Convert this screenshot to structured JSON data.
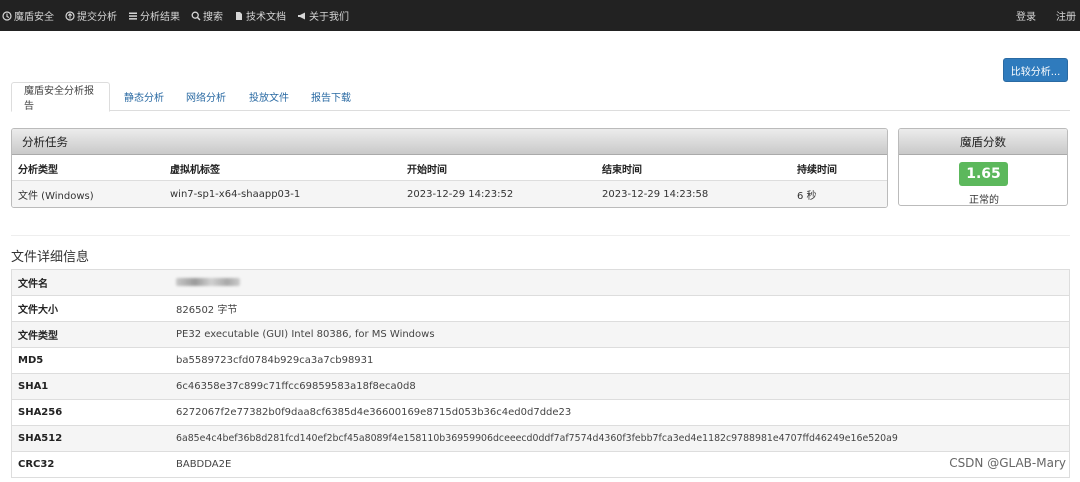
{
  "nav": {
    "items": [
      {
        "label": "魔盾安全",
        "icon": "shield-icon"
      },
      {
        "label": "提交分析",
        "icon": "upload-circle-icon"
      },
      {
        "label": "分析结果",
        "icon": "list-icon"
      },
      {
        "label": "搜索",
        "icon": "search-icon"
      },
      {
        "label": "技术文档",
        "icon": "document-icon"
      },
      {
        "label": "关于我们",
        "icon": "megaphone-icon"
      }
    ],
    "login": "登录",
    "register": "注册"
  },
  "compare_button": "比较分析...",
  "tabs": [
    "魔盾安全分析报告",
    "静态分析",
    "网络分析",
    "投放文件",
    "报告下载"
  ],
  "task": {
    "title": "分析任务",
    "columns": [
      "分析类型",
      "虚拟机标签",
      "开始时间",
      "结束时间",
      "持续时间"
    ],
    "row": [
      "文件 (Windows)",
      "win7-sp1-x64-shaapp03-1",
      "2023-12-29 14:23:52",
      "2023-12-29 14:23:58",
      "6 秒"
    ]
  },
  "score": {
    "title": "魔盾分数",
    "value": "1.65",
    "label": "正常的",
    "color": "#5cb85c"
  },
  "details": {
    "title": "文件详细信息",
    "rows": [
      {
        "key": "文件名",
        "value": ""
      },
      {
        "key": "文件大小",
        "value": "826502 字节"
      },
      {
        "key": "文件类型",
        "value": "PE32 executable (GUI) Intel 80386, for MS Windows"
      },
      {
        "key": "MD5",
        "value": "ba5589723cfd0784b929ca3a7cb98931"
      },
      {
        "key": "SHA1",
        "value": "6c46358e37c899c71ffcc69859583a18f8eca0d8"
      },
      {
        "key": "SHA256",
        "value": "6272067f2e77382b0f9daa8cf6385d4e36600169e8715d053b36c4ed0d7dde23"
      },
      {
        "key": "SHA512",
        "value": "6a85e4c4bef36b8d281fcd140ef2bcf45a8089f4e158110b36959906dceeecd0ddf7af7574d4360f3febb7fca3ed4e1182c9788981e4707ffd46249e16e520a9"
      },
      {
        "key": "CRC32",
        "value": "BABDDA2E"
      }
    ]
  },
  "watermark": "CSDN @GLAB-Mary"
}
